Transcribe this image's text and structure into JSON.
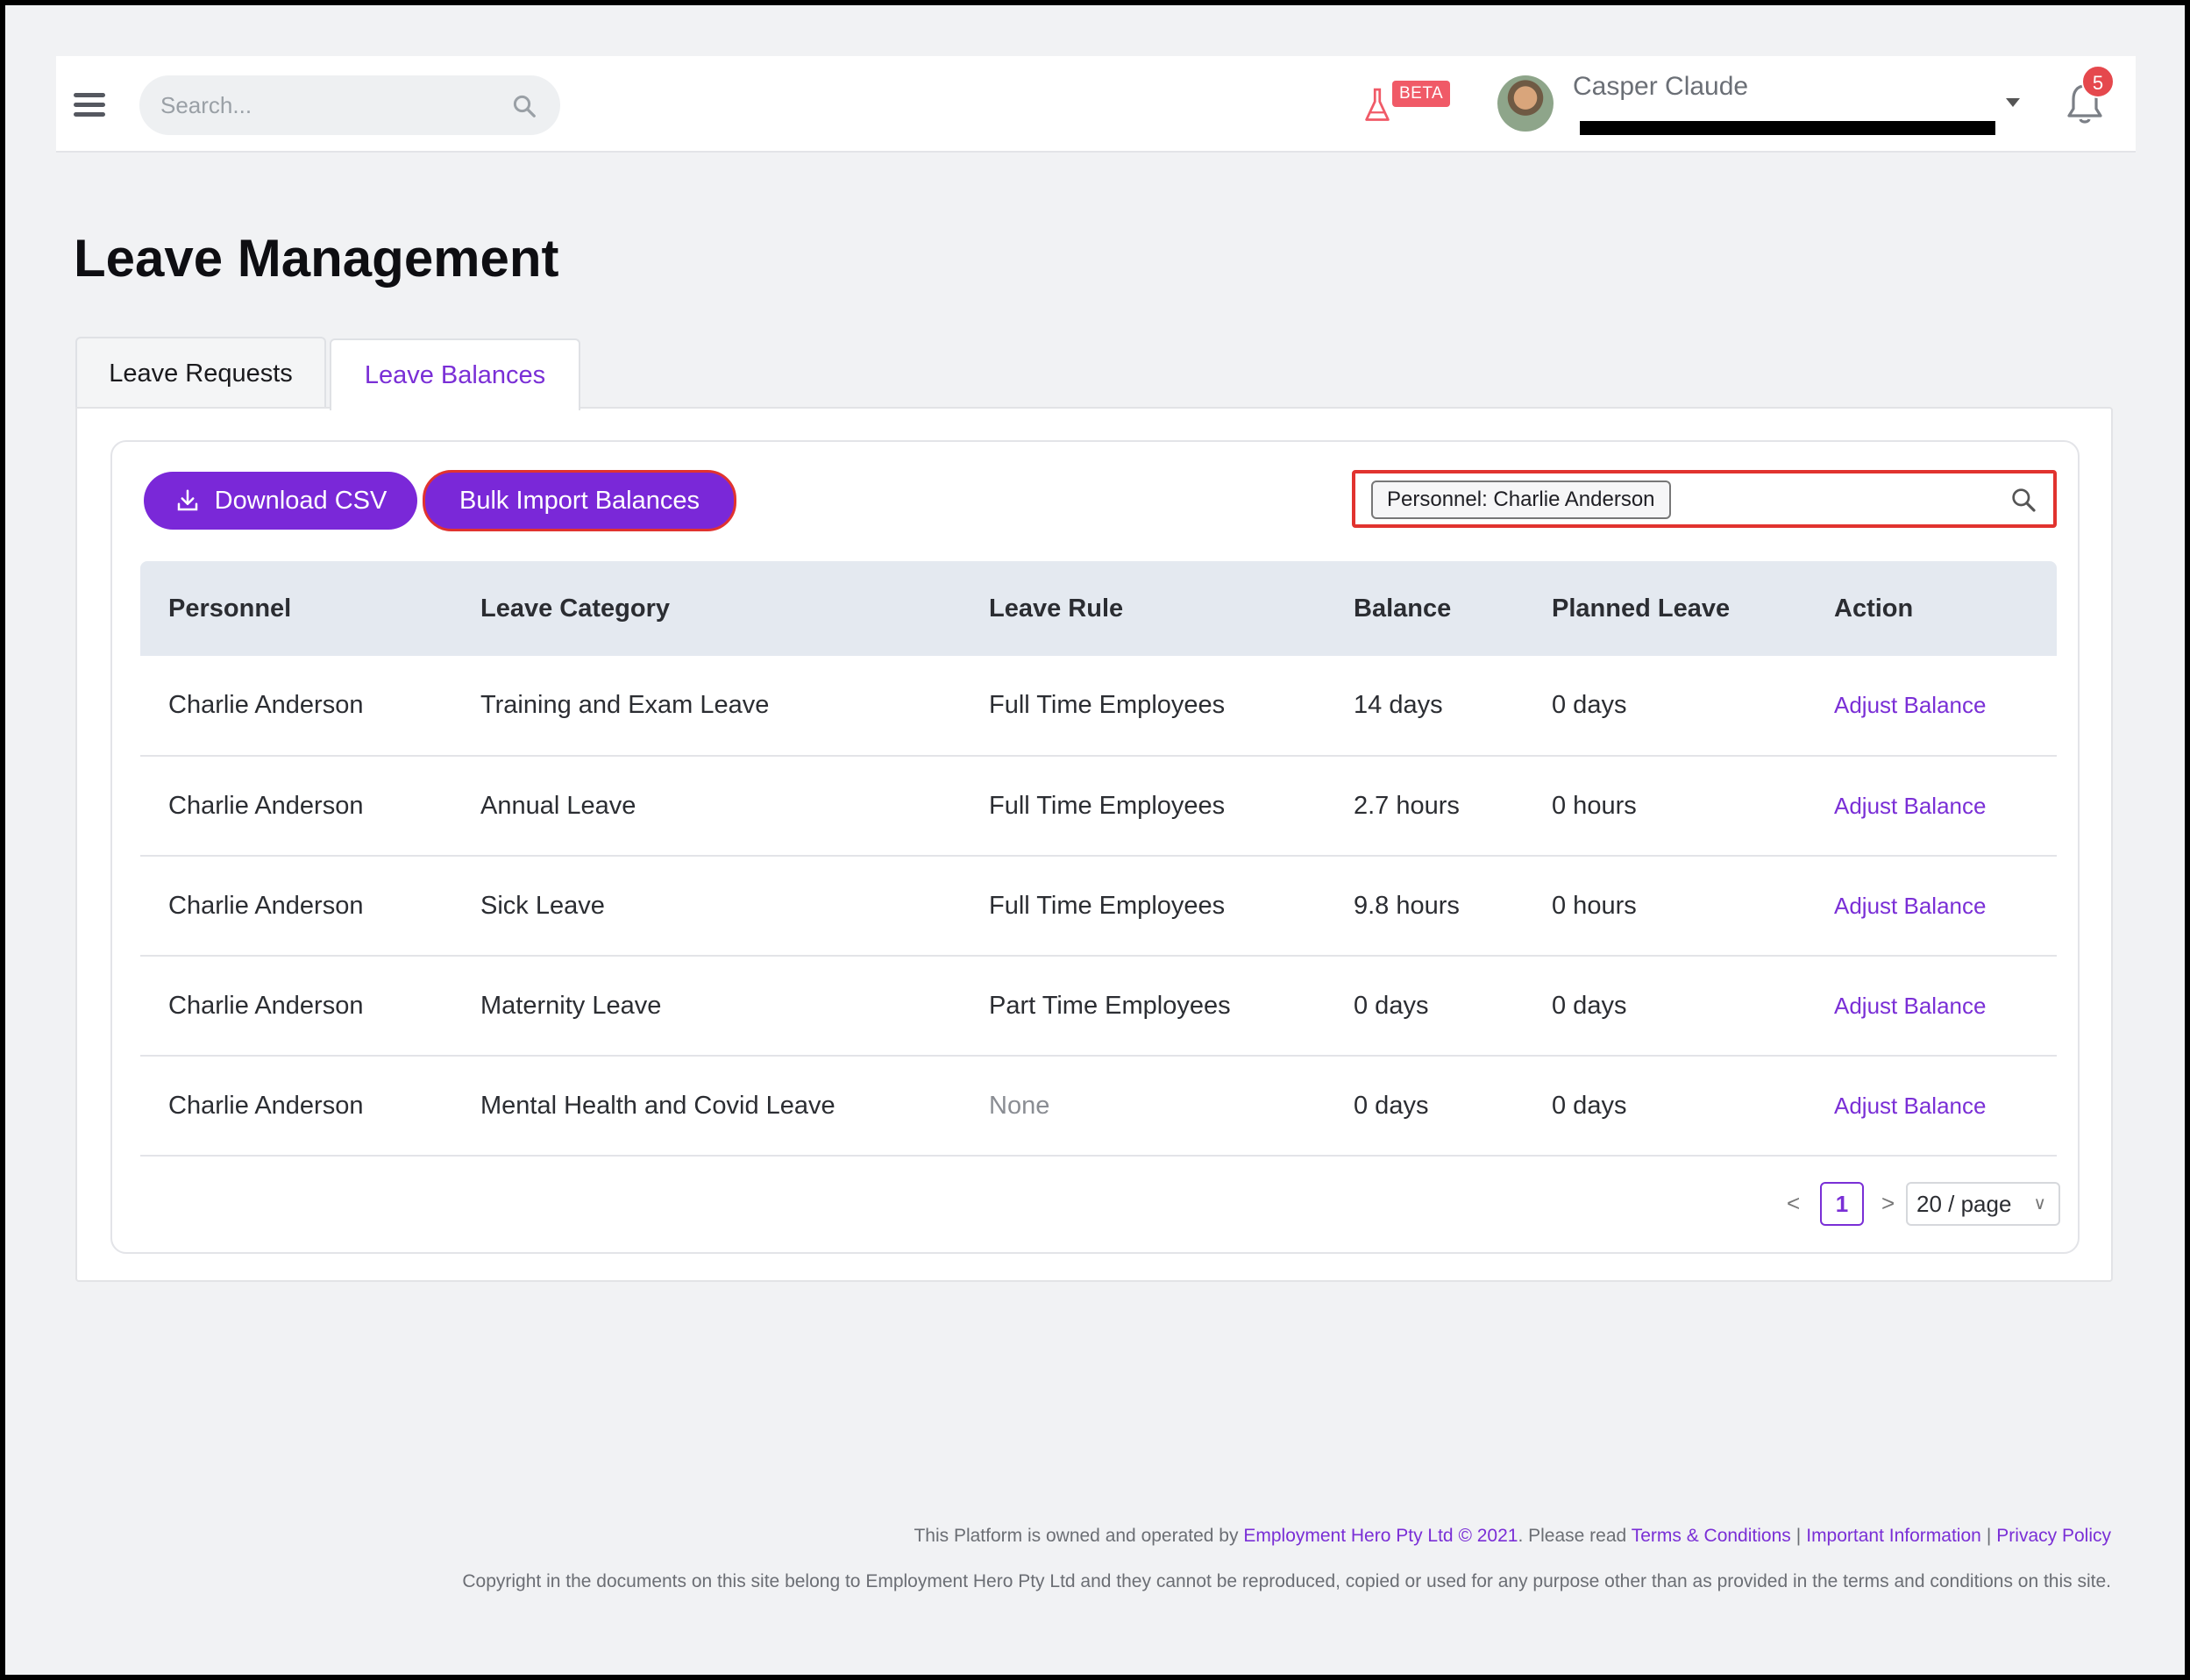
{
  "header": {
    "search_placeholder": "Search...",
    "beta_label": "BETA",
    "user_name": "Casper Claude",
    "notification_count": "5"
  },
  "page": {
    "title": "Leave Management"
  },
  "tabs": [
    {
      "label": "Leave Requests",
      "active": false
    },
    {
      "label": "Leave Balances",
      "active": true
    }
  ],
  "toolbar": {
    "download_csv_label": "Download CSV",
    "bulk_import_label": "Bulk Import Balances",
    "filter_chip_label": "Personnel: Charlie Anderson"
  },
  "table": {
    "columns": [
      "Personnel",
      "Leave Category",
      "Leave Rule",
      "Balance",
      "Planned Leave",
      "Action"
    ],
    "rows": [
      {
        "personnel": "Charlie Anderson",
        "category": "Training and Exam Leave",
        "rule": "Full Time Employees",
        "balance": "14 days",
        "planned": "0 days",
        "action": "Adjust Balance"
      },
      {
        "personnel": "Charlie Anderson",
        "category": "Annual Leave",
        "rule": "Full Time Employees",
        "balance": "2.7 hours",
        "planned": "0 hours",
        "action": "Adjust Balance"
      },
      {
        "personnel": "Charlie Anderson",
        "category": "Sick Leave",
        "rule": "Full Time Employees",
        "balance": "9.8 hours",
        "planned": "0 hours",
        "action": "Adjust Balance"
      },
      {
        "personnel": "Charlie Anderson",
        "category": "Maternity Leave",
        "rule": "Part Time Employees",
        "balance": "0 days",
        "planned": "0 days",
        "action": "Adjust Balance"
      },
      {
        "personnel": "Charlie Anderson",
        "category": "Mental Health and Covid Leave",
        "rule": "None",
        "balance": "0 days",
        "planned": "0 days",
        "action": "Adjust Balance"
      }
    ]
  },
  "pagination": {
    "prev": "<",
    "current_page": "1",
    "next": ">",
    "page_size": "20 / page"
  },
  "footer": {
    "owned_text": "This Platform is owned and operated by",
    "company_link": "Employment Hero Pty Ltd © 2021",
    "please_read": ". Please read",
    "terms_link": "Terms & Conditions",
    "important_link": "Important Information",
    "privacy_link": "Privacy Policy",
    "copyright": "Copyright in the documents on this site belong to Employment Hero Pty Ltd and they cannot be reproduced, copied or used for any purpose other than as provided in the terms and conditions on this site."
  },
  "colors": {
    "accent": "#7a28d8",
    "highlight_border": "#e1332f",
    "badge": "#e5484d"
  }
}
